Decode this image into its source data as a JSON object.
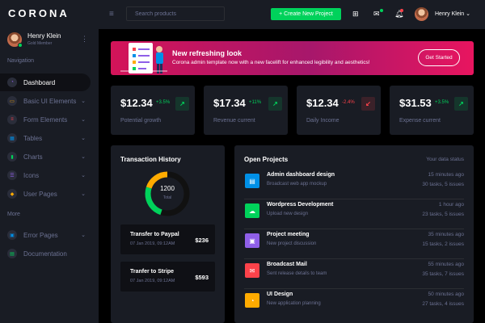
{
  "brand": "CORONA",
  "sidebar": {
    "profile": {
      "name": "Henry Klein",
      "role": "Gold Member",
      "menu_icon": "more-vertical-icon"
    },
    "nav_heading": "Navigation",
    "items": [
      {
        "label": "Dashboard",
        "icon": "speedometer-icon",
        "color": "#8f5fe8",
        "active": true
      },
      {
        "label": "Basic UI Elements",
        "icon": "laptop-icon",
        "color": "#ffab00",
        "chevron": true
      },
      {
        "label": "Form Elements",
        "icon": "playlist-icon",
        "color": "#fc424a",
        "chevron": true
      },
      {
        "label": "Tables",
        "icon": "table-icon",
        "color": "#0090e7",
        "chevron": true
      },
      {
        "label": "Charts",
        "icon": "chart-icon",
        "color": "#00d25b",
        "chevron": true
      },
      {
        "label": "Icons",
        "icon": "contacts-icon",
        "color": "#8f5fe8",
        "chevron": true
      },
      {
        "label": "User Pages",
        "icon": "security-icon",
        "color": "#ffab00",
        "chevron": true
      }
    ],
    "more_heading": "More",
    "more_items": [
      {
        "label": "Error Pages",
        "icon": "lock-icon",
        "color": "#0090e7",
        "chevron": true
      },
      {
        "label": "Documentation",
        "icon": "file-document-icon",
        "color": "#00d25b"
      }
    ]
  },
  "topbar": {
    "search_placeholder": "Search products",
    "create_label": "+ Create New Project",
    "user_name": "Henry Klein"
  },
  "banner": {
    "title": "New refreshing look",
    "text": "Corona admin template now with a new facelift for enhanced legibility and aesthetics!",
    "button": "Get Started"
  },
  "stats": [
    {
      "value": "$12.34",
      "change": "+3.5%",
      "trend": "up",
      "label": "Potential growth"
    },
    {
      "value": "$17.34",
      "change": "+11%",
      "trend": "up",
      "label": "Revenue current"
    },
    {
      "value": "$12.34",
      "change": "-2.4%",
      "trend": "down",
      "label": "Daily Income"
    },
    {
      "value": "$31.53",
      "change": "+3.5%",
      "trend": "up",
      "label": "Expense current"
    }
  ],
  "colors": {
    "success": "#00d25b",
    "danger": "#fc424a",
    "warning": "#ffab00",
    "primary": "#0090e7",
    "purple": "#8f5fe8"
  },
  "transactions": {
    "title": "Transaction History",
    "donut_value": "1200",
    "donut_label": "Total",
    "donut_segments": [
      {
        "value": 55,
        "color": "#111111"
      },
      {
        "value": 25,
        "color": "#00d25b"
      },
      {
        "value": 20,
        "color": "#ffab00"
      }
    ],
    "items": [
      {
        "name": "Transfer to Paypal",
        "date": "07 Jan 2019, 09:12AM",
        "amount": "$236"
      },
      {
        "name": "Tranfer to Stripe",
        "date": "07 Jan 2019, 09:12AM",
        "amount": "$593"
      }
    ]
  },
  "projects": {
    "title": "Open Projects",
    "subtitle": "Your data status",
    "items": [
      {
        "name": "Admin dashboard design",
        "desc": "Broadcast web app mockup",
        "time": "15 minutes ago",
        "meta": "30 tasks, 5 issues",
        "color": "#0090e7",
        "icon": "file-icon"
      },
      {
        "name": "Wordpress Development",
        "desc": "Upload new design",
        "time": "1 hour ago",
        "meta": "23 tasks, 5 issues",
        "color": "#00d25b",
        "icon": "cloud-download-icon"
      },
      {
        "name": "Project meeting",
        "desc": "New project discussion",
        "time": "35 minutes ago",
        "meta": "15 tasks, 2 issues",
        "color": "#8f5fe8",
        "icon": "clipboard-icon"
      },
      {
        "name": "Broadcast Mail",
        "desc": "Sent release details to team",
        "time": "55 minutes ago",
        "meta": "35 tasks, 7 issues",
        "color": "#fc424a",
        "icon": "mail-icon"
      },
      {
        "name": "UI Design",
        "desc": "New application planning",
        "time": "50 minutes ago",
        "meta": "27 tasks, 4 issues",
        "color": "#ffab00",
        "icon": "chart-icon"
      }
    ]
  }
}
